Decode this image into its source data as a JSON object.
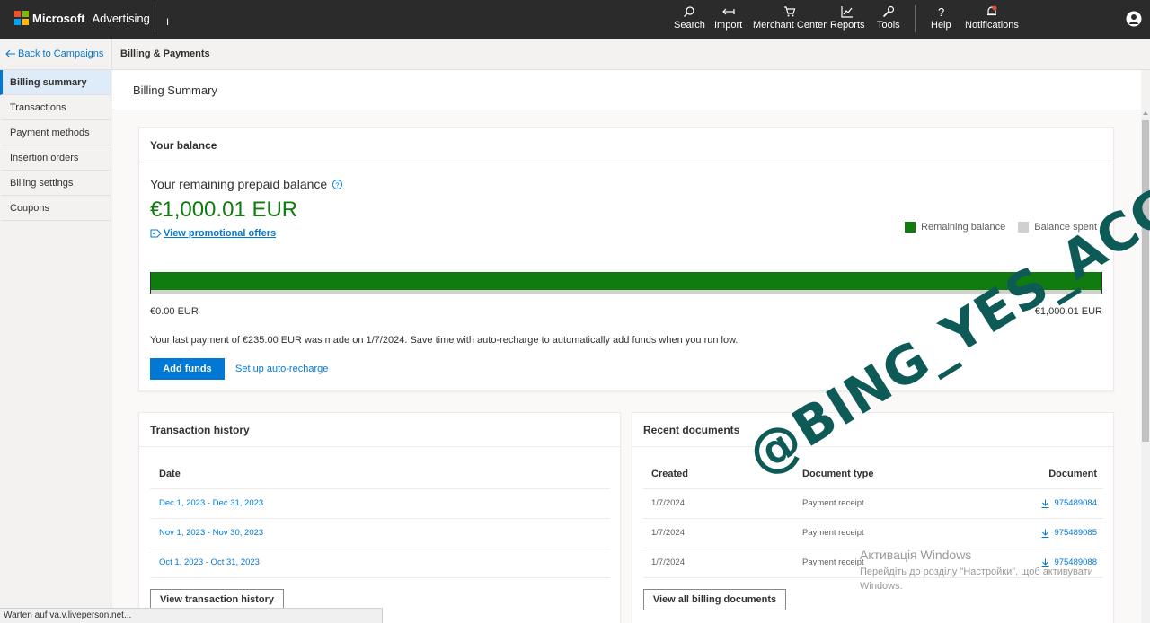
{
  "topbar": {
    "brand": "Microsoft",
    "product": "Advertising",
    "cursor_char": "I",
    "nav": [
      {
        "label": "Search",
        "icon": "search-icon"
      },
      {
        "label": "Import",
        "icon": "import-icon"
      },
      {
        "label": "Merchant Center",
        "icon": "cart-icon"
      },
      {
        "label": "Reports",
        "icon": "reports-icon"
      },
      {
        "label": "Tools",
        "icon": "tools-icon"
      },
      {
        "label": "Help",
        "icon": "help-icon"
      },
      {
        "label": "Notifications",
        "icon": "bell-icon"
      }
    ]
  },
  "breadcrumb": {
    "back_label": "Back to Campaigns",
    "current": "Billing & Payments"
  },
  "sidebar": {
    "items": [
      {
        "label": "Billing summary",
        "active": true
      },
      {
        "label": "Transactions",
        "active": false
      },
      {
        "label": "Payment methods",
        "active": false
      },
      {
        "label": "Insertion orders",
        "active": false
      },
      {
        "label": "Billing settings",
        "active": false
      },
      {
        "label": "Coupons",
        "active": false
      }
    ]
  },
  "page": {
    "title": "Billing Summary"
  },
  "balance": {
    "card_title": "Your balance",
    "label": "Your remaining prepaid balance",
    "amount": "€1,000.01 EUR",
    "promo_link": "View promotional offers",
    "legend_remaining": "Remaining balance",
    "legend_spent": "Balance spent",
    "remaining_fraction": 1.0,
    "bar_min": "€0.00 EUR",
    "bar_max": "€1,000.01 EUR",
    "last_payment_text": "Your last payment of €235.00 EUR was made on 1/7/2024. Save time with auto-recharge to automatically add funds when you run low.",
    "add_funds": "Add funds",
    "auto_recharge": "Set up auto-recharge",
    "colors": {
      "remaining": "#107c10",
      "spent": "#d2d0ce"
    }
  },
  "transactions": {
    "card_title": "Transaction history",
    "column": "Date",
    "rows": [
      "Dec 1, 2023 - Dec 31, 2023",
      "Nov 1, 2023 - Nov 30, 2023",
      "Oct 1, 2023 - Oct 31, 2023"
    ],
    "button": "View transaction history"
  },
  "documents": {
    "card_title": "Recent documents",
    "columns": {
      "created": "Created",
      "type": "Document type",
      "document": "Document"
    },
    "rows": [
      {
        "created": "1/7/2024",
        "type": "Payment receipt",
        "document": "975489084"
      },
      {
        "created": "1/7/2024",
        "type": "Payment receipt",
        "document": "975489085"
      },
      {
        "created": "1/7/2024",
        "type": "Payment receipt",
        "document": "975489088"
      }
    ],
    "button": "View all billing documents"
  },
  "status_bar": "Warten auf va.v.liveperson.net...",
  "windows_activation": {
    "title": "Активація Windows",
    "message": "Перейдіть до розділу \"Настройки\", щоб активувати Windows."
  },
  "watermark": "@BING_YES_ACC"
}
